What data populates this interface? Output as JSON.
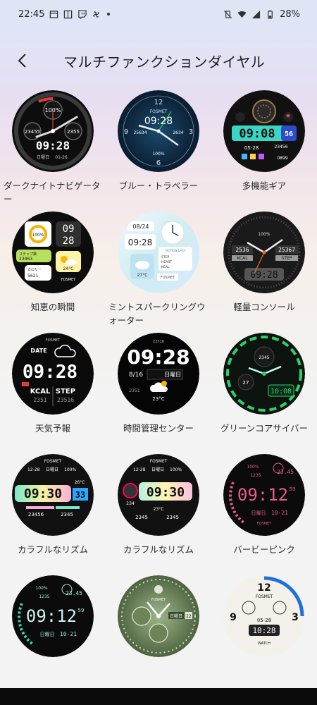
{
  "status_bar": {
    "time": "22:45",
    "battery": "28%"
  },
  "header": {
    "title": "マルチファンクションダイヤル"
  },
  "dials": [
    {
      "name": "ダークナイトナビゲーター",
      "texts": [
        "100%",
        "23455",
        "2355",
        "09:28",
        "日曜日",
        "01-26"
      ]
    },
    {
      "name": "ブルー・トラベラー",
      "texts": [
        "FOSMET",
        "09:28",
        "25634",
        "2634",
        "100%",
        "12",
        "3",
        "6",
        "9"
      ]
    },
    {
      "name": "多機能ギア",
      "texts": [
        "09:08",
        "56",
        "05-28",
        "23456",
        "0899"
      ]
    },
    {
      "name": "知恵の瞬間",
      "texts": [
        "100%",
        "09",
        "28",
        "ステップ数",
        "23463",
        "カロリー",
        "5621",
        "24°C",
        "FOSMET"
      ]
    },
    {
      "name": "ミントスパークリングウォーター",
      "texts": [
        "08/24",
        "09:28",
        "MOTION DATA",
        "STEP",
        "HEART",
        "KCAL",
        "27°C",
        "FOSMET"
      ]
    },
    {
      "name": "軽量コンソール",
      "texts": [
        "100%",
        "2536",
        "25367",
        "KCAL",
        "STEP",
        "09:28"
      ]
    },
    {
      "name": "天気予報",
      "texts": [
        "FOSMET",
        "DATE",
        "09:28",
        "KCAL",
        "STEP",
        "2351",
        "23516"
      ]
    },
    {
      "name": "時間管理センター",
      "texts": [
        "23516",
        "09:28",
        "8/16",
        "日曜日",
        "23°C",
        "2351"
      ]
    },
    {
      "name": "グリーンコアサイバー",
      "texts": [
        "2345",
        "27",
        "10:08"
      ]
    },
    {
      "name": "カラフルなリズム",
      "texts": [
        "FOSMET",
        "12-28",
        "日曜日",
        "100%",
        "09:30",
        "33",
        "26°C",
        "23456",
        "2345"
      ]
    },
    {
      "name": "カラフルなリズム",
      "texts": [
        "FOSMET",
        "12-28",
        "日曜日",
        "100%",
        "09:30",
        "234",
        "23°C",
        "2345",
        "2345"
      ]
    },
    {
      "name": "バービーピンク",
      "texts": [
        "100%",
        "23.45",
        "1235",
        "09:12",
        "59",
        "日曜日",
        "10-21",
        "FOSMET"
      ]
    },
    {
      "name": "",
      "texts": [
        "100%",
        "23.45",
        "1235",
        "09:12",
        "59",
        "日曜日",
        "10-21"
      ]
    },
    {
      "name": "",
      "texts": [
        "FOSMET",
        "日曜日",
        "22"
      ]
    },
    {
      "name": "",
      "texts": [
        "FOSMET",
        "12",
        "05-28",
        "10:28",
        "9",
        "3",
        "WATCH"
      ]
    }
  ]
}
